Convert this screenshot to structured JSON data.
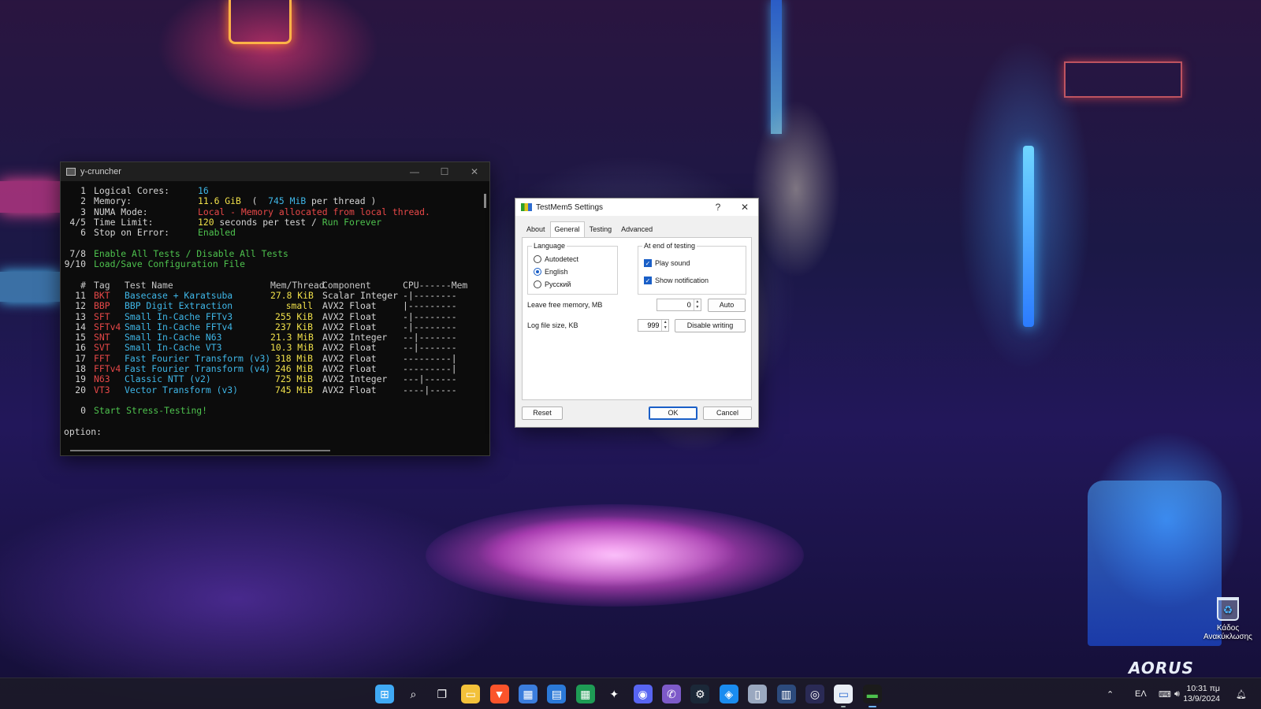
{
  "terminal": {
    "title": "y-cruncher",
    "settings": [
      {
        "num": "1",
        "label": "Logical Cores:",
        "parts": [
          {
            "t": "16",
            "c": "cyan"
          }
        ]
      },
      {
        "num": "2",
        "label": "Memory:",
        "parts": [
          {
            "t": "11.6 GiB",
            "c": "yellow"
          },
          {
            "t": "  (  ",
            "c": "white"
          },
          {
            "t": "745 MiB",
            "c": "cyan"
          },
          {
            "t": " per thread )",
            "c": "white"
          }
        ]
      },
      {
        "num": "3",
        "label": "NUMA Mode:",
        "parts": [
          {
            "t": "Local - Memory allocated from local thread.",
            "c": "red"
          }
        ]
      },
      {
        "num": "4/5",
        "label": "Time Limit:",
        "parts": [
          {
            "t": "120",
            "c": "yellow"
          },
          {
            "t": " seconds per test / ",
            "c": "white"
          },
          {
            "t": "Run Forever",
            "c": "green"
          }
        ]
      },
      {
        "num": "6",
        "label": "Stop on Error:",
        "parts": [
          {
            "t": "Enabled",
            "c": "green"
          }
        ]
      }
    ],
    "commands": [
      {
        "num": "7/8",
        "text": "Enable All Tests / Disable All Tests"
      },
      {
        "num": "9/10",
        "text": "Load/Save Configuration File"
      }
    ],
    "table_headers": [
      "#",
      "Tag",
      "Test Name",
      "Mem/Thread",
      "Component",
      "CPU------Mem"
    ],
    "tests": [
      {
        "num": "11",
        "tag": "BKT",
        "name": "Basecase + Karatsuba",
        "mem": "27.8 KiB",
        "comp": "Scalar Integer",
        "cpu": "-|--------"
      },
      {
        "num": "12",
        "tag": "BBP",
        "name": "BBP Digit Extraction",
        "mem": "small",
        "comp": "AVX2 Float",
        "cpu": "|---------"
      },
      {
        "num": "13",
        "tag": "SFT",
        "name": "Small In-Cache FFTv3",
        "mem": "255 KiB",
        "comp": "AVX2 Float",
        "cpu": "-|--------"
      },
      {
        "num": "14",
        "tag": "SFTv4",
        "name": "Small In-Cache FFTv4",
        "mem": "237 KiB",
        "comp": "AVX2 Float",
        "cpu": "-|--------"
      },
      {
        "num": "15",
        "tag": "SNT",
        "name": "Small In-Cache N63",
        "mem": "21.3 MiB",
        "comp": "AVX2 Integer",
        "cpu": "--|-------"
      },
      {
        "num": "16",
        "tag": "SVT",
        "name": "Small In-Cache VT3",
        "mem": "10.3 MiB",
        "comp": "AVX2 Float",
        "cpu": "--|-------"
      },
      {
        "num": "17",
        "tag": "FFT",
        "name": "Fast Fourier Transform (v3)",
        "mem": "318 MiB",
        "comp": "AVX2 Float",
        "cpu": "---------|"
      },
      {
        "num": "18",
        "tag": "FFTv4",
        "name": "Fast Fourier Transform (v4)",
        "mem": "246 MiB",
        "comp": "AVX2 Float",
        "cpu": "---------|"
      },
      {
        "num": "19",
        "tag": "N63",
        "name": "Classic NTT (v2)",
        "mem": "725 MiB",
        "comp": "AVX2 Integer",
        "cpu": "---|------"
      },
      {
        "num": "20",
        "tag": "VT3",
        "name": "Vector Transform (v3)",
        "mem": "745 MiB",
        "comp": "AVX2 Float",
        "cpu": "----|-----"
      }
    ],
    "start": {
      "num": "0",
      "text": "Start Stress-Testing!"
    },
    "prompt": "option:"
  },
  "dialog": {
    "title": "TestMem5 Settings",
    "help": "?",
    "close": "✕",
    "tabs": [
      "About",
      "General",
      "Testing",
      "Advanced"
    ],
    "active_tab": "General",
    "language_group": "Language",
    "language_options": [
      "Autodetect",
      "English",
      "Русский"
    ],
    "language_selected": "English",
    "end_group": "At end of testing",
    "play_sound": "Play sound",
    "show_notification": "Show notification",
    "free_memory_label": "Leave free memory, MB",
    "free_memory_value": "0",
    "auto_button": "Auto",
    "log_size_label": "Log file size, KB",
    "log_size_value": "999",
    "disable_writing_button": "Disable writing",
    "reset_button": "Reset",
    "ok_button": "OK",
    "cancel_button": "Cancel"
  },
  "desktop": {
    "recycle_bin_label": "Κάδος Ανακύκλωσης",
    "brand": "AORUS"
  },
  "taskbar": {
    "language": "ΕΛ",
    "time": "10:31 πμ",
    "date": "13/9/2024",
    "icons": [
      "windows-start-icon",
      "search-icon",
      "task-view-icon",
      "file-explorer-icon",
      "brave-icon",
      "store-icon",
      "notes-icon",
      "spreadsheet-icon",
      "game-icon",
      "discord-icon",
      "viber-icon",
      "steam-icon",
      "bing-icon",
      "phone-icon",
      "monitor-icon",
      "circle-app-icon",
      "testmem-icon",
      "terminal-icon"
    ]
  }
}
